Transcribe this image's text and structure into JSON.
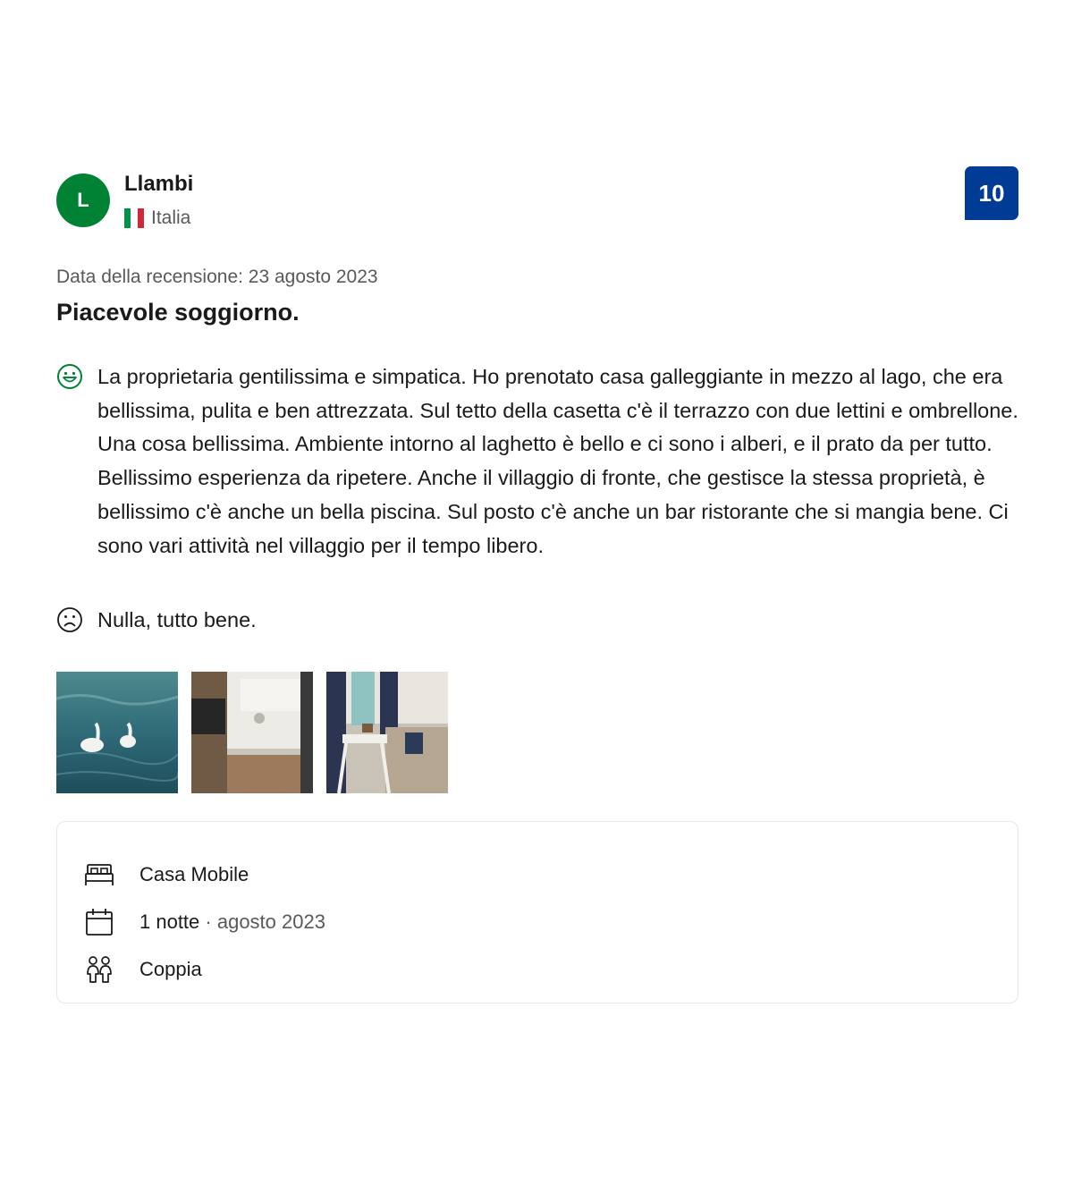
{
  "reviewer": {
    "initial": "L",
    "name": "Llambi",
    "country": "Italia",
    "flag_colors": [
      "#009246",
      "#ffffff",
      "#ce2b37"
    ],
    "avatar_color": "#008234"
  },
  "score": "10",
  "score_color": "#003b95",
  "review_date": "Data della recensione: 23 agosto 2023",
  "title": "Piacevole soggiorno.",
  "positive": {
    "icon": "happy-face-icon",
    "text": "La proprietaria gentilissima e simpatica. Ho prenotato casa galleggiante in mezzo al lago, che era bellissima, pulita e ben attrezzata. Sul tetto della casetta c'è il terrazzo con due lettini e ombrellone. Una cosa bellissima. Ambiente intorno al laghetto è bello e ci sono i alberi, e il prato da per tutto. Bellissimo esperienza da ripetere. Anche il villaggio di fronte, che gestisce la stessa proprietà, è bellissimo c'è anche un bella piscina. Sul posto c'è anche un bar ristorante che si mangia bene. Ci sono vari attività nel villaggio per il tempo libero."
  },
  "negative": {
    "icon": "sad-face-icon",
    "text": "Nulla, tutto bene."
  },
  "photos": [
    {
      "subject": "swans on lake"
    },
    {
      "subject": "kitchen"
    },
    {
      "subject": "living room"
    }
  ],
  "stay": {
    "room": {
      "icon": "bed-icon",
      "text": "Casa Mobile"
    },
    "nights": {
      "icon": "calendar-icon",
      "text": "1 notte",
      "separator": " · ",
      "date": "agosto 2023"
    },
    "traveler": {
      "icon": "couple-icon",
      "text": "Coppia"
    }
  }
}
